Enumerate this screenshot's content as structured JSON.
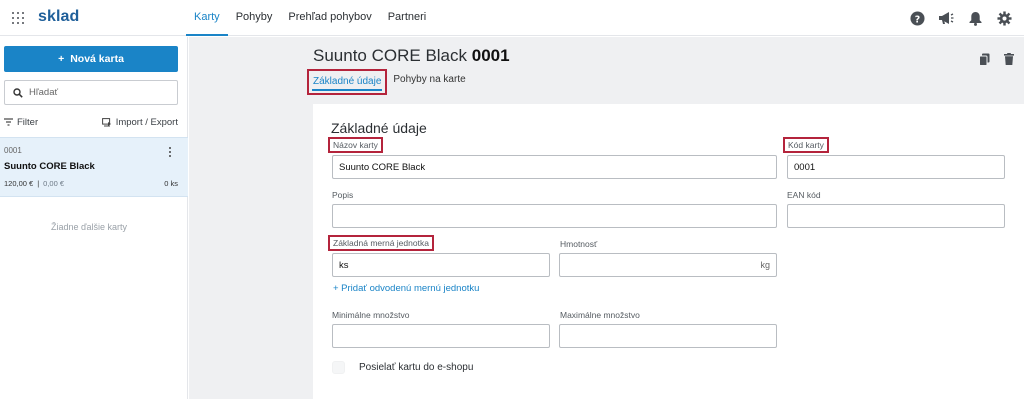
{
  "app": {
    "brand": "sklad"
  },
  "nav": {
    "items": [
      "Karty",
      "Pohyby",
      "Prehľad pohybov",
      "Partneri"
    ],
    "active": 0
  },
  "top_icons": [
    "help-icon",
    "megaphone-icon",
    "bell-icon",
    "gear-icon"
  ],
  "sidebar": {
    "new_button": "Nová karta",
    "search_placeholder": "Hľadať",
    "filter_label": "Filter",
    "import_export_label": "Import / Export",
    "cards": [
      {
        "code": "0001",
        "name": "Suunto CORE Black",
        "price": "120,00 €",
        "price_secondary": "0,00 €",
        "separator": "|",
        "qty": "0 ks"
      }
    ],
    "empty_note": "Žiadne ďalšie karty"
  },
  "detail": {
    "title_name": "Suunto CORE Black",
    "title_code": "0001",
    "tabs": [
      "Základné údaje",
      "Pohyby na karte"
    ],
    "active_tab": 0,
    "section_title": "Základné údaje",
    "fields": {
      "nazov_label": "Názov karty",
      "nazov_value": "Suunto CORE Black",
      "kod_label": "Kód karty",
      "kod_value": "0001",
      "popis_label": "Popis",
      "popis_value": "",
      "ean_label": "EAN kód",
      "ean_value": "",
      "jednotka_label": "Základná merná jednotka",
      "jednotka_value": "ks",
      "hmotnost_label": "Hmotnosť",
      "hmotnost_value": "",
      "hmotnost_unit": "kg",
      "add_unit_link": "+ Pridať odvodenú mernú jednotku",
      "min_label": "Minimálne množstvo",
      "min_value": "",
      "max_label": "Maximálne množstvo",
      "max_value": "",
      "eshop_label": "Posielať kartu do e-shopu",
      "eshop_checked": false
    }
  },
  "colors": {
    "accent": "#1a84c7",
    "highlight": "#b4243c",
    "brand": "#1f5f9a"
  }
}
